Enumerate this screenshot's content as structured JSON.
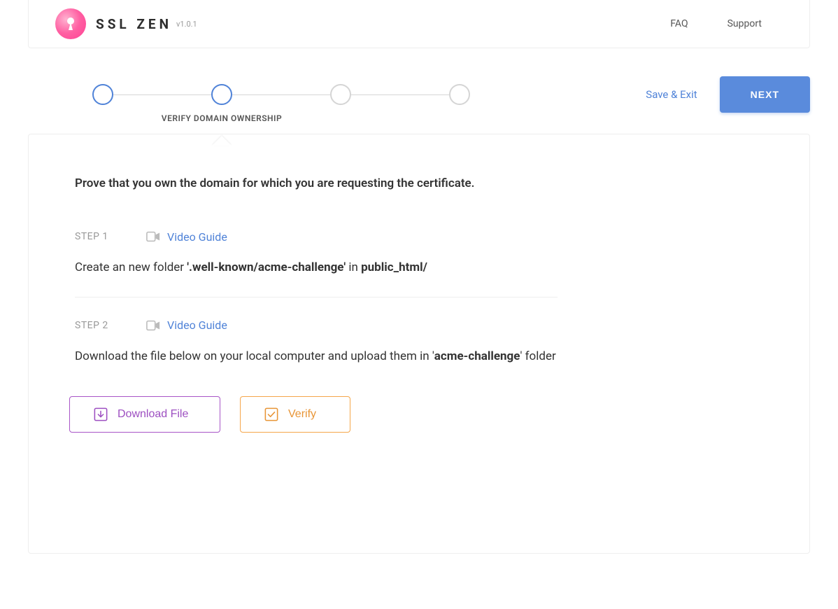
{
  "header": {
    "brand": "SSL ZEN",
    "version": "v1.0.1",
    "nav": {
      "faq": "FAQ",
      "support": "Support"
    }
  },
  "stepper": {
    "current_label": "VERIFY DOMAIN OWNERSHIP",
    "save_exit": "Save & Exit",
    "next": "NEXT"
  },
  "main": {
    "intro": "Prove that you own the domain for which you are requesting the certificate.",
    "step1": {
      "label": "STEP 1",
      "video_guide": "Video Guide",
      "desc_pre": "Create an new folder ",
      "desc_bold1": "'.well-known/acme-challenge'",
      "desc_mid": " in ",
      "desc_bold2": "public_html/"
    },
    "step2": {
      "label": "STEP 2",
      "video_guide": "Video Guide",
      "desc_pre": "Download the file below on your local computer and upload them in '",
      "desc_bold": "acme-challenge",
      "desc_post": "' folder"
    },
    "buttons": {
      "download": "Download File",
      "verify": "Verify"
    }
  }
}
